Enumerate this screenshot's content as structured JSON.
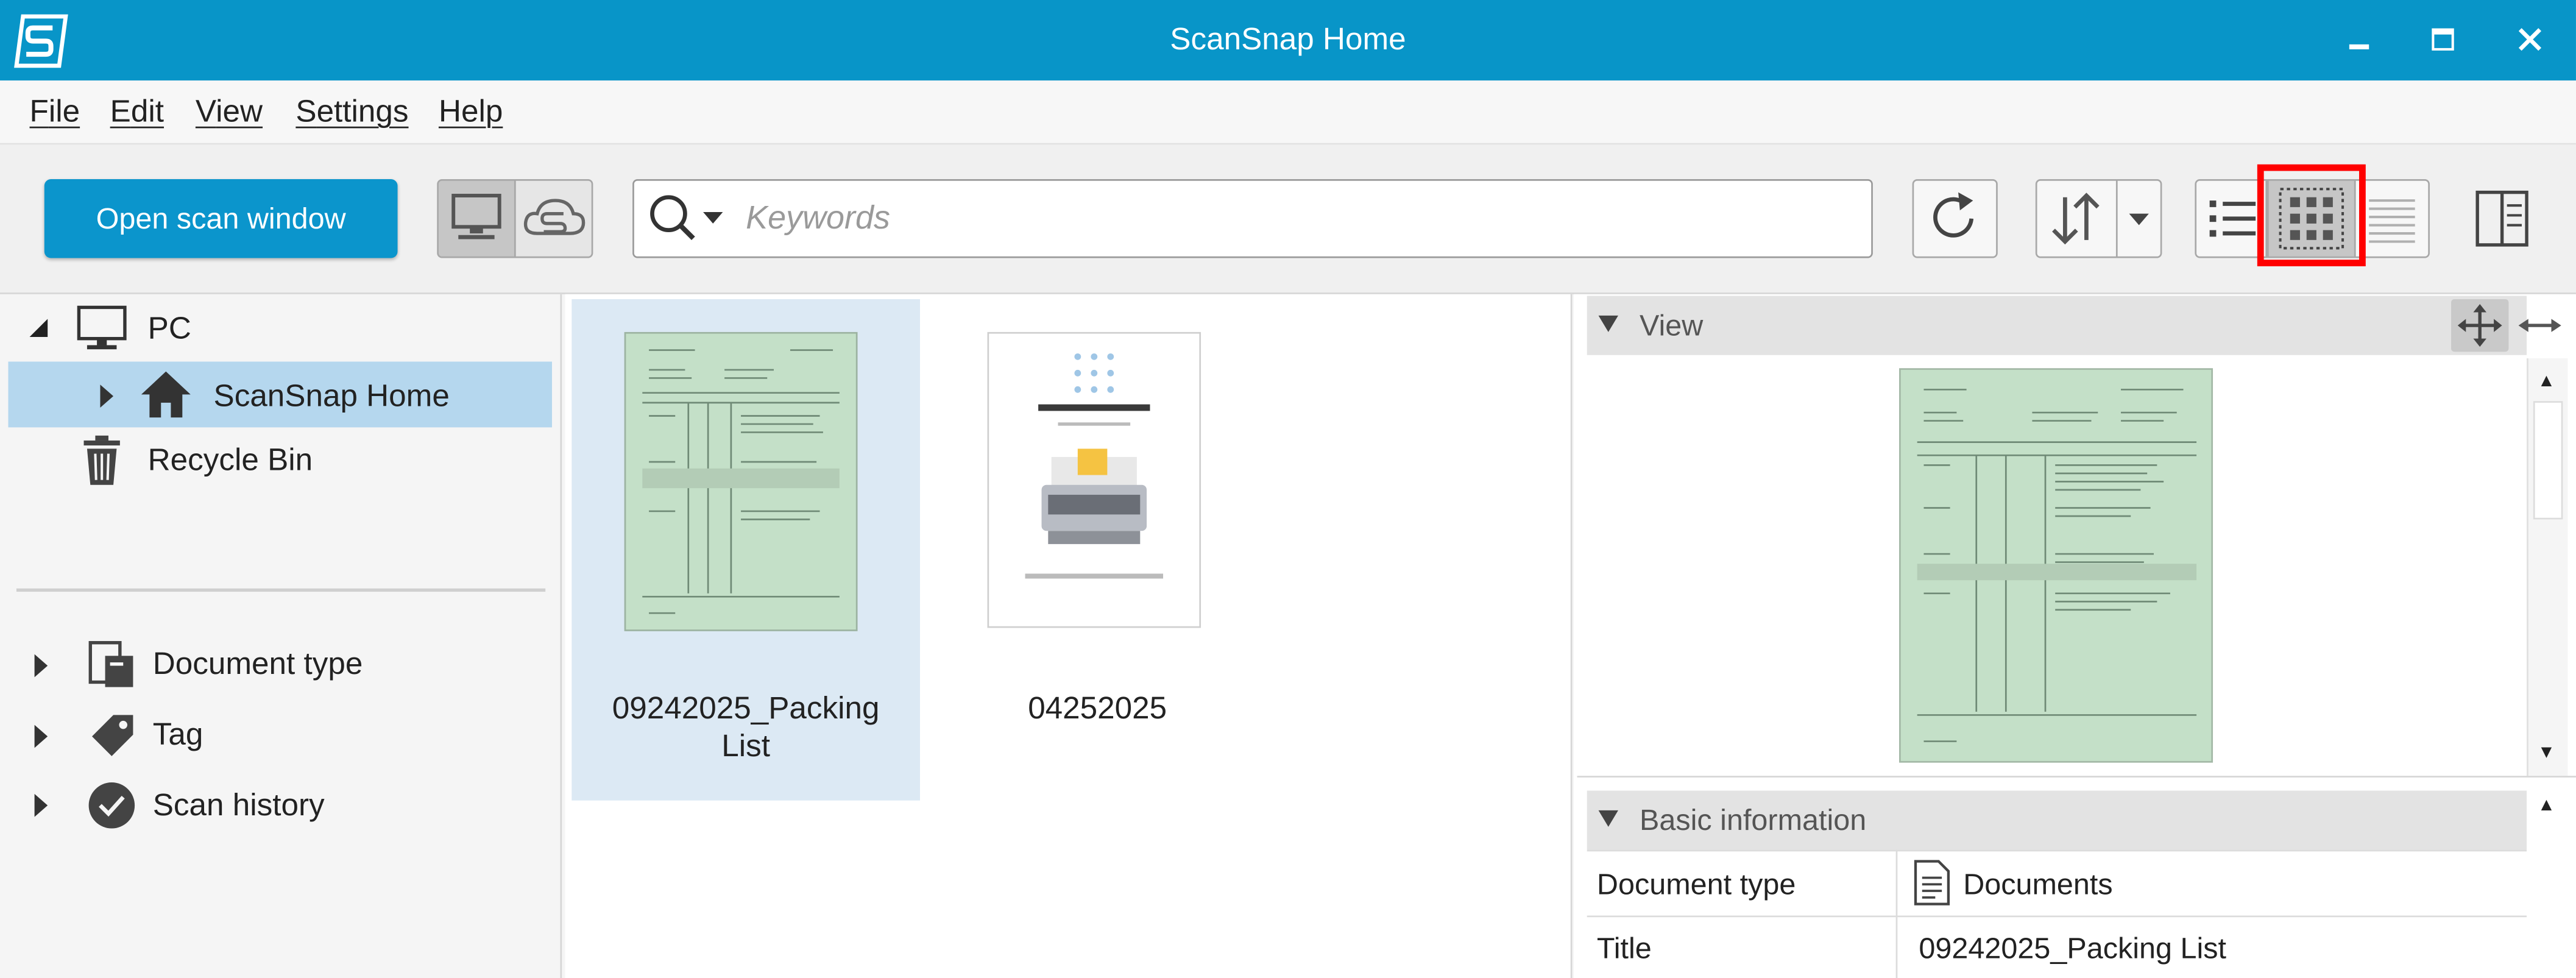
{
  "window": {
    "title": "ScanSnap Home"
  },
  "menu": [
    {
      "key": "F",
      "rest": "ile"
    },
    {
      "key": "E",
      "rest": "dit"
    },
    {
      "key": "V",
      "rest": "iew"
    },
    {
      "key": "S",
      "rest": "ettings"
    },
    {
      "key": "H",
      "rest": "elp"
    }
  ],
  "toolbar": {
    "open_scan_label": "Open scan window",
    "search_placeholder": "Keywords"
  },
  "tree": {
    "pc": "PC",
    "scansnap_home": "ScanSnap Home",
    "recycle_bin": "Recycle Bin",
    "document_type": "Document type",
    "tag": "Tag",
    "scan_history": "Scan history"
  },
  "documents": [
    {
      "line1": "09242025_Packing",
      "line2": "List"
    },
    {
      "line1": "04252025"
    }
  ],
  "view_panel": {
    "title": "View"
  },
  "basic_info": {
    "title": "Basic information",
    "rows": [
      {
        "label": "Document type",
        "value": "Documents"
      },
      {
        "label": "Title",
        "value": "09242025_Packing List"
      }
    ]
  },
  "colors": {
    "accent": "#0895c8",
    "selection": "#b5d7ee",
    "highlight": "#ff0000"
  }
}
